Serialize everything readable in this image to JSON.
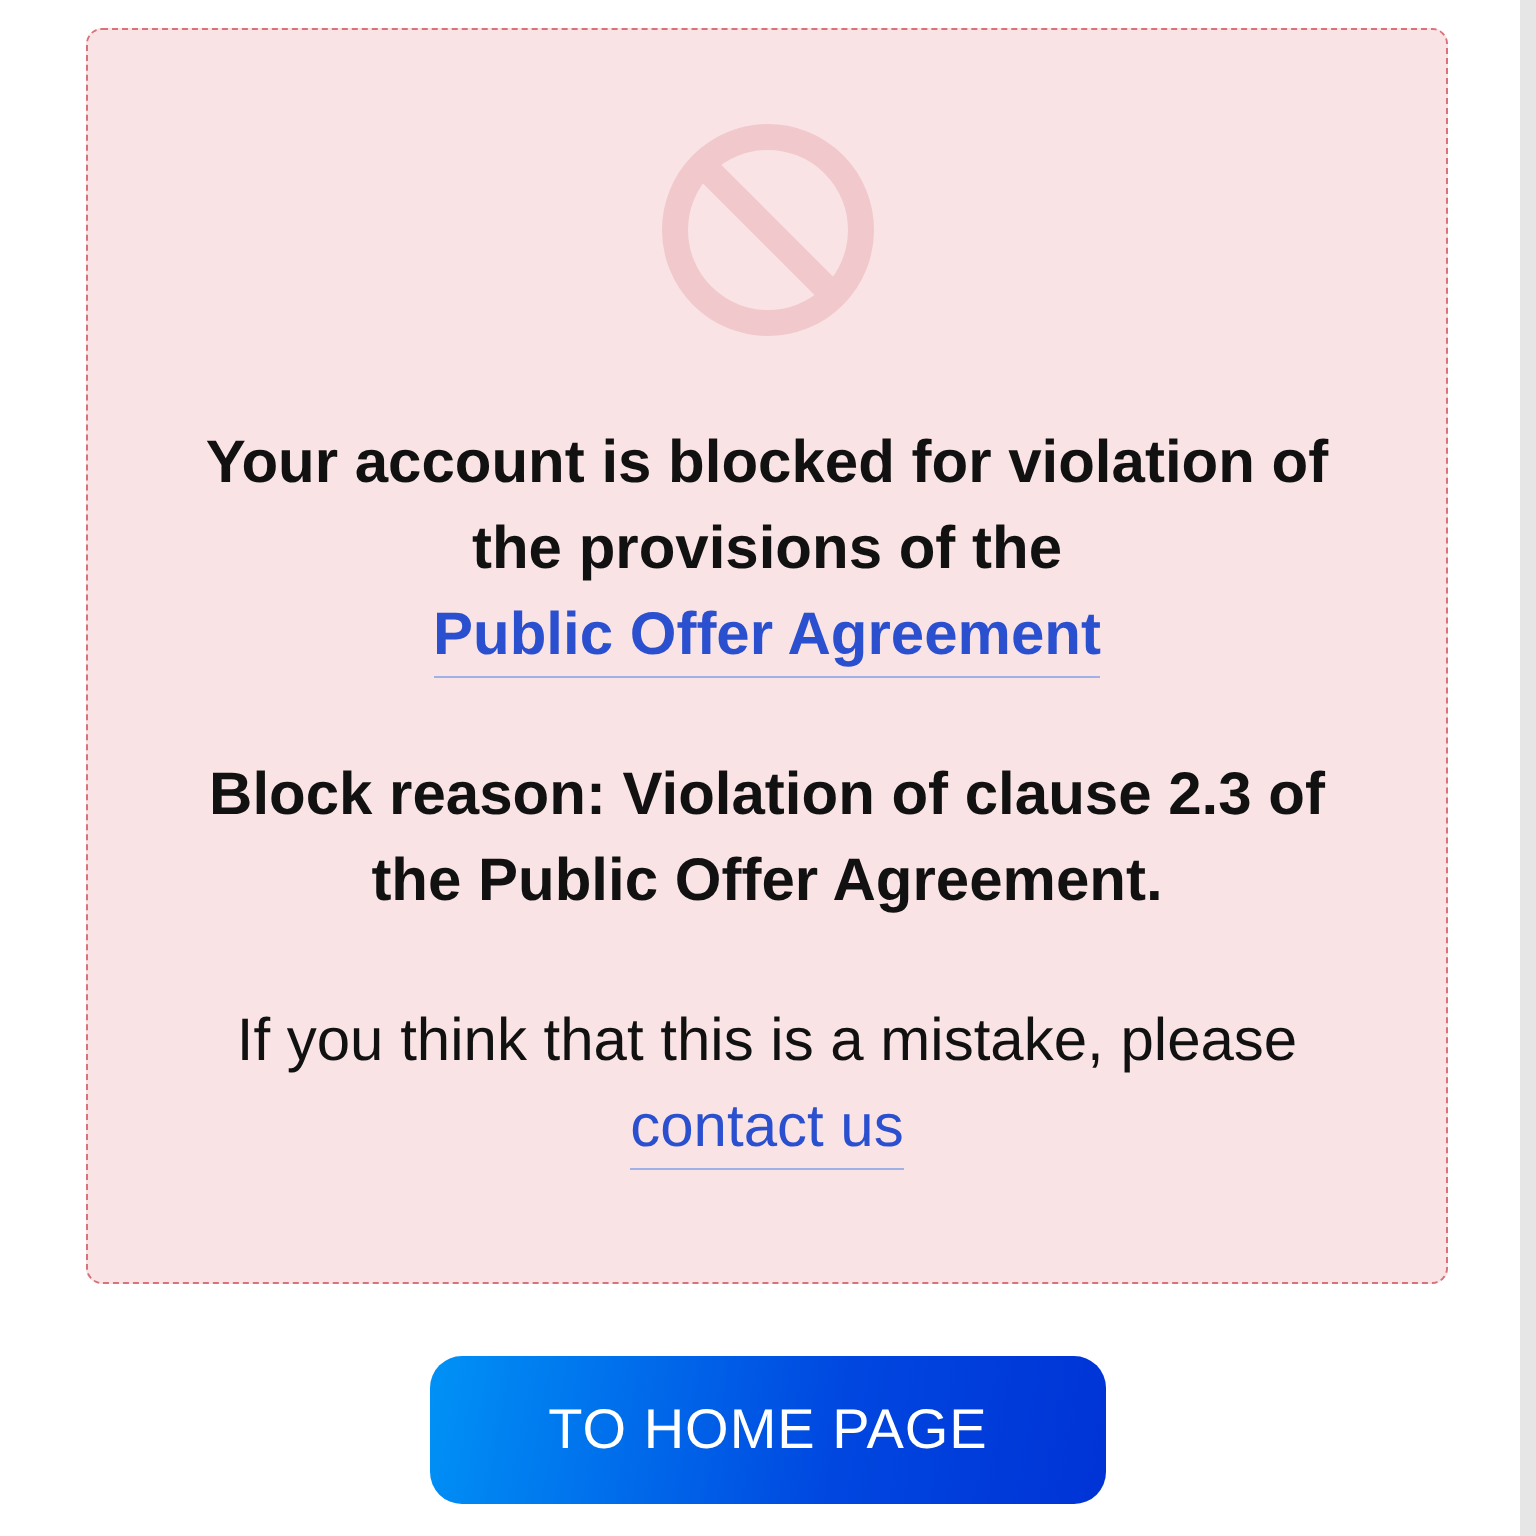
{
  "notice": {
    "paragraphs": [
      {
        "kind": "bold",
        "parts": [
          {
            "kind": "text",
            "text": "Your account is blocked for violation of the provisions of the "
          },
          {
            "kind": "link",
            "text": "Public Offer Agreement"
          }
        ]
      },
      {
        "kind": "bold",
        "parts": [
          {
            "kind": "text",
            "text": "Block reason: Violation of clause 2.3 of the Public Offer Agreement."
          }
        ]
      },
      {
        "kind": "regular",
        "parts": [
          {
            "kind": "text",
            "text": "If you think that this is a mistake, please "
          },
          {
            "kind": "link",
            "text": "contact us"
          }
        ]
      }
    ]
  },
  "home_button": {
    "label": "TO HOME PAGE"
  }
}
